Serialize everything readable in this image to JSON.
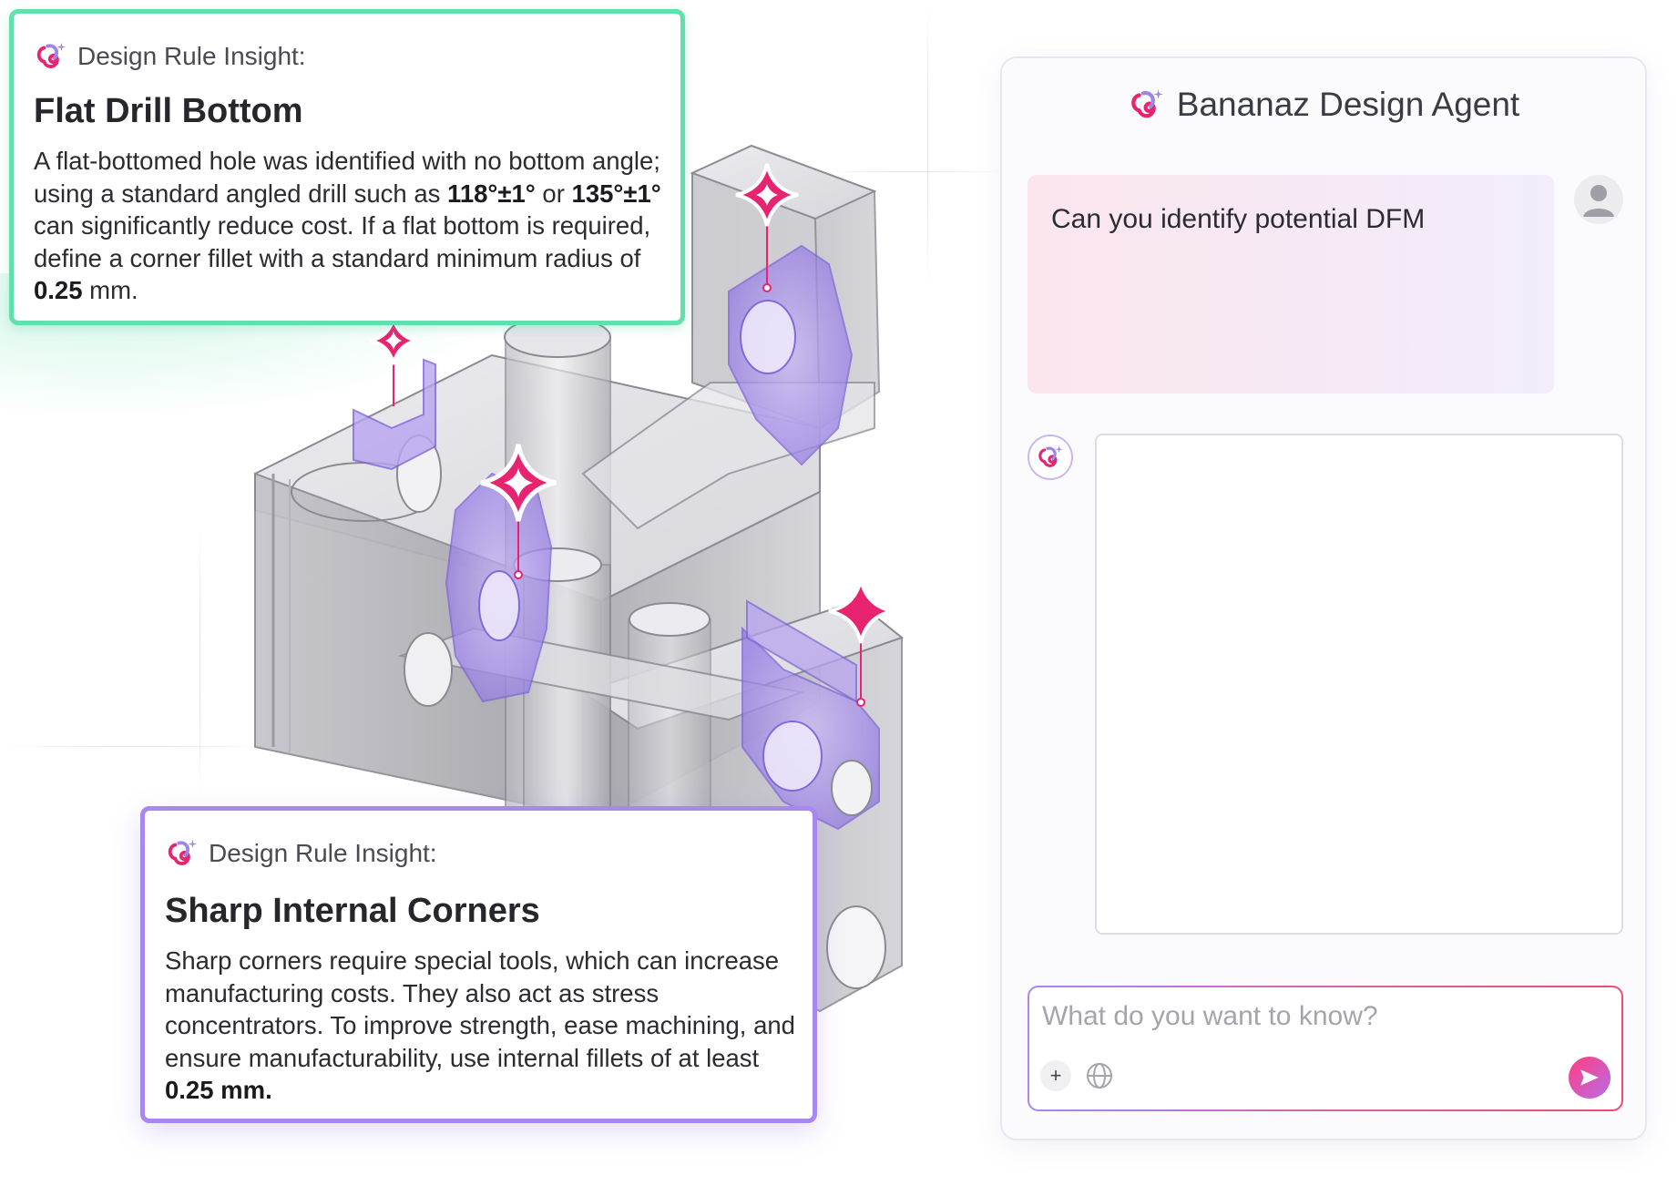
{
  "colors": {
    "insight_green": "#5fe0ae",
    "insight_purple": "#a887ee",
    "marker_pink": "#e8236f",
    "highlight_purple": "#9c84ea"
  },
  "insight_top": {
    "header_label": "Design Rule Insight:",
    "title": "Flat Drill Bottom",
    "body": [
      {
        "t": "A flat-bottomed hole was identified with no bottom angle; using a standard angled drill such as ",
        "b": false
      },
      {
        "t": "118°±1°",
        "b": true
      },
      {
        "t": " or ",
        "b": false
      },
      {
        "t": "135°±1°",
        "b": true
      },
      {
        "t": " can significantly reduce cost. If a flat bottom is required, define a corner fillet with a standard minimum radius of ",
        "b": false
      },
      {
        "t": "0.25",
        "b": true
      },
      {
        "t": " mm.",
        "b": false
      }
    ]
  },
  "insight_bottom": {
    "header_label": "Design Rule Insight:",
    "title": "Sharp Internal Corners",
    "body": [
      {
        "t": "Sharp corners require special tools, which can increase manufacturing costs. They also act as stress concentrators. To improve strength, ease machining, and ensure manufacturability, use internal fillets of at least ",
        "b": false
      },
      {
        "t": "0.25 mm.",
        "b": true
      }
    ]
  },
  "chat": {
    "title": "Bananaz Design Agent",
    "user_message": "Can you identify potential DFM",
    "input_placeholder": "What do you want to know?",
    "icons": {
      "brand": "bananaz-logo-icon",
      "user": "user-avatar-icon",
      "add": "plus-icon",
      "web": "globe-icon",
      "send": "send-icon"
    }
  }
}
